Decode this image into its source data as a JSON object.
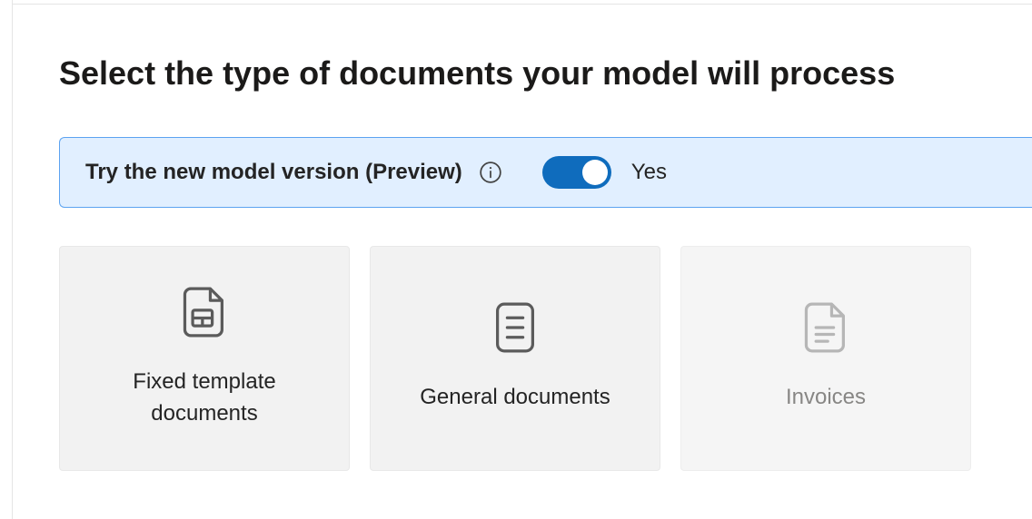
{
  "title": "Select the type of documents your model will process",
  "preview": {
    "label": "Try the new model version (Preview)",
    "state_label": "Yes"
  },
  "options": [
    {
      "label": "Fixed template documents"
    },
    {
      "label": "General documents"
    },
    {
      "label": "Invoices"
    }
  ]
}
